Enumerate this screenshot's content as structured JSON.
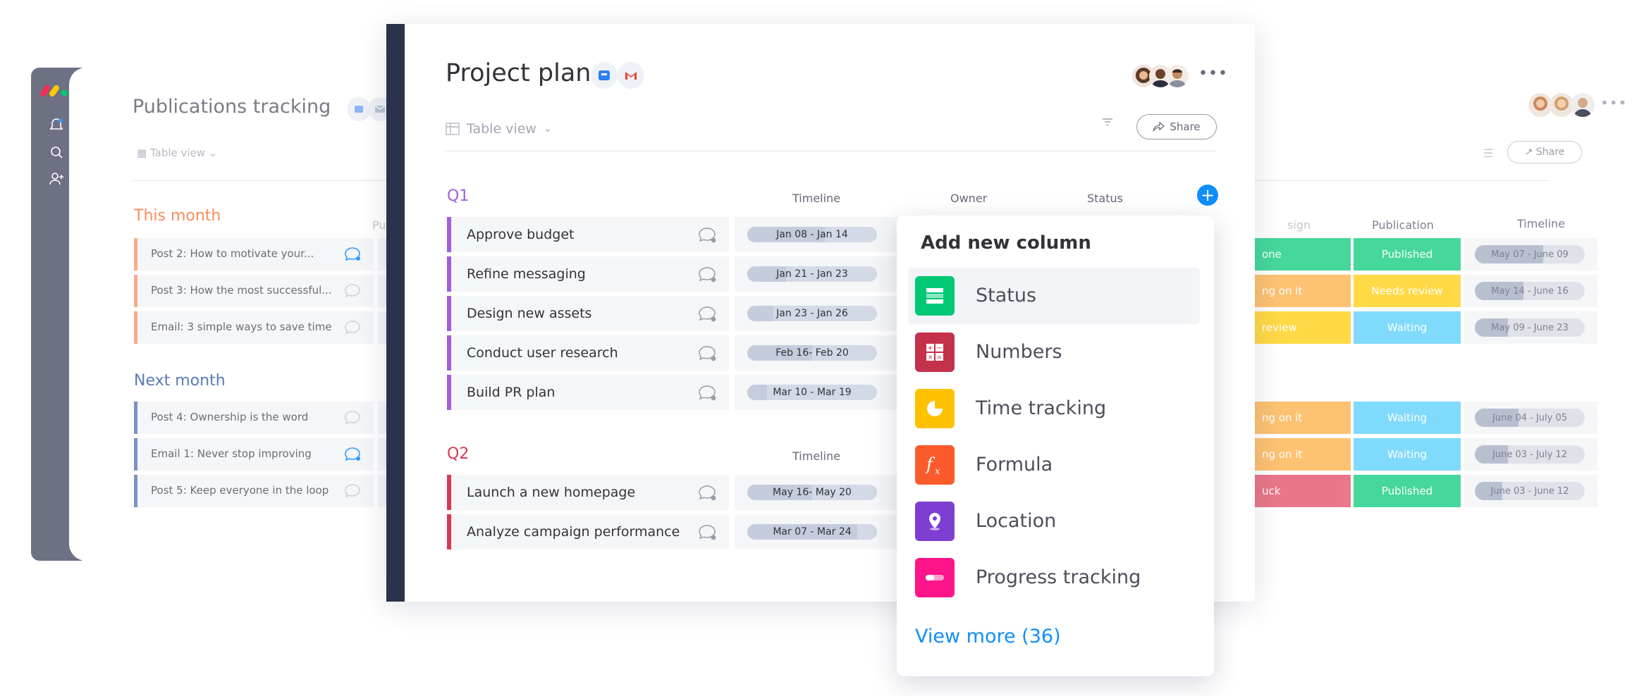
{
  "background_board": {
    "title": "Publications tracking",
    "table_view": "Table view",
    "share_label": "Share",
    "groups": [
      {
        "title": "This month",
        "color": "#fb8c5a",
        "rows": [
          "Post 2: How to motivate your...",
          "Post 3: How the most successful...",
          "Email: 3 simple ways to save time"
        ]
      },
      {
        "title": "Next month",
        "color": "#5a7bb5",
        "rows": [
          "Post 4: Ownership is the word",
          "Email 1: Never stop improving",
          "Post 5: Keep everyone in the loop"
        ]
      }
    ],
    "columns": {
      "publisher": "Publisher",
      "design": "sign",
      "publication": "Publication",
      "timeline": "Timeline"
    },
    "design_cells": [
      "one",
      "ng on it",
      "review",
      "ng on it",
      "ng on it",
      "uck"
    ],
    "publication_cells": [
      "Published",
      "Needs review",
      "Waiting",
      "Waiting",
      "Waiting",
      "Published"
    ],
    "timeline_cells": [
      "May 07 - June 09",
      "May 14 - June 16",
      "May 09 - June 23",
      "June 04 - July 05",
      "June 03 - July 12",
      "June 03 - June 12"
    ]
  },
  "project_plan": {
    "title": "Project plan",
    "table_view": "Table view",
    "share_label": "Share",
    "more_label": "•••",
    "add_label": "+",
    "columns": {
      "timeline": "Timeline",
      "owner": "Owner",
      "status": "Status"
    },
    "groups": [
      {
        "title": "Q1",
        "color": "#a25ddc",
        "rows": [
          {
            "name": "Approve budget",
            "timeline": "Jan 08 - Jan 14"
          },
          {
            "name": "Refine messaging",
            "timeline": "Jan 21 - Jan 23"
          },
          {
            "name": "Design new assets",
            "timeline": "Jan 23 - Jan 26"
          },
          {
            "name": "Conduct user research",
            "timeline": "Feb 16- Feb 20"
          },
          {
            "name": "Build PR plan",
            "timeline": "Mar 10 - Mar 19"
          }
        ]
      },
      {
        "title": "Q2",
        "color": "#d83a52",
        "rows": [
          {
            "name": "Launch a new homepage",
            "timeline": "May 16- May 20"
          },
          {
            "name": "Analyze campaign performance",
            "timeline": "Mar 07 - Mar 24"
          }
        ]
      }
    ]
  },
  "add_column_menu": {
    "title": "Add new column",
    "items": [
      {
        "label": "Status",
        "icon": "status-icon",
        "color": "#00c875"
      },
      {
        "label": "Numbers",
        "icon": "numbers-icon",
        "color": "#c4314b"
      },
      {
        "label": "Time tracking",
        "icon": "time-tracking-icon",
        "color": "#fdc100"
      },
      {
        "label": "Formula",
        "icon": "formula-icon",
        "color": "#fb5b2c"
      },
      {
        "label": "Location",
        "icon": "location-icon",
        "color": "#7e3ed1"
      },
      {
        "label": "Progress tracking",
        "icon": "progress-tracking-icon",
        "color": "#ff158a"
      }
    ],
    "view_more": "View more (36)"
  }
}
